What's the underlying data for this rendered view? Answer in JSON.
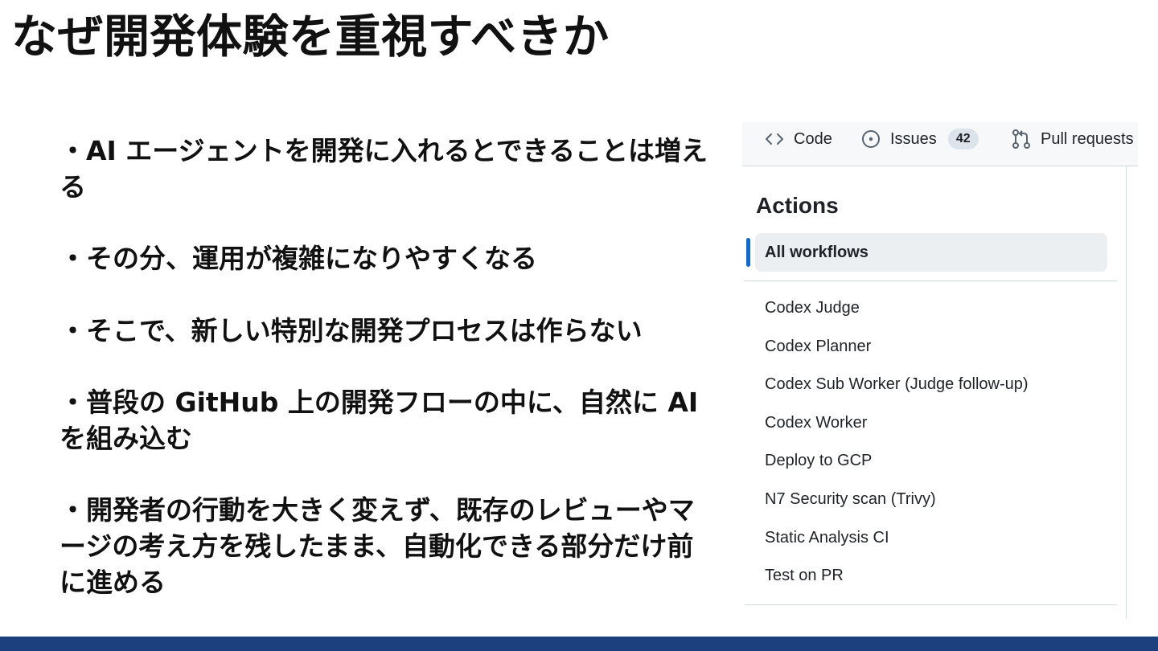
{
  "slide": {
    "title": "なぜ開発体験を重視すべきか",
    "bullets": [
      "・AI エージェントを開発に入れるとできることは増える",
      "・その分、運用が複雑になりやすくなる",
      "・そこで、新しい特別な開発プロセスは作らない",
      "・普段の GitHub 上の開発フローの中に、自然に AI を組み込む",
      "・開発者の行動を大きく変えず、既存のレビューやマージの考え方を残したまま、自動化できる部分だけ前に進める"
    ],
    "footer_color": "#1c3f7e"
  },
  "github": {
    "tabs": {
      "code": {
        "label": "Code",
        "icon": "code-icon"
      },
      "issues": {
        "label": "Issues",
        "count": "42",
        "icon": "issue-opened-icon"
      },
      "pulls": {
        "label": "Pull requests",
        "icon": "git-pull-request-icon"
      }
    },
    "actions_heading": "Actions",
    "selected_workflow": "All workflows",
    "workflows": [
      "Codex Judge",
      "Codex Planner",
      "Codex Sub Worker (Judge follow-up)",
      "Codex Worker",
      "Deploy to GCP",
      "N7 Security scan (Trivy)",
      "Static Analysis CI",
      "Test on PR"
    ],
    "accent_color": "#0969da"
  }
}
